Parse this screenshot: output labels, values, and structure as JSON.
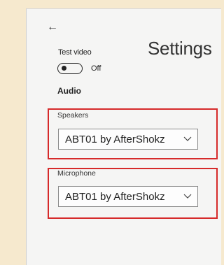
{
  "header": {
    "back_glyph": "←",
    "title": "Settings"
  },
  "video": {
    "label": "Test video",
    "toggle_state": "Off",
    "toggle_on": false
  },
  "audio": {
    "heading": "Audio",
    "speakers": {
      "label": "Speakers",
      "value": "ABT01 by AfterShokz"
    },
    "microphone": {
      "label": "Microphone",
      "value": "ABT01 by AfterShokz"
    }
  },
  "colors": {
    "backdrop": "#f6e9ce",
    "panel": "#f5f5f4",
    "highlight": "#d62a2a"
  },
  "icons": {
    "back": "back-arrow-icon",
    "dropdown": "chevron-down-icon"
  }
}
